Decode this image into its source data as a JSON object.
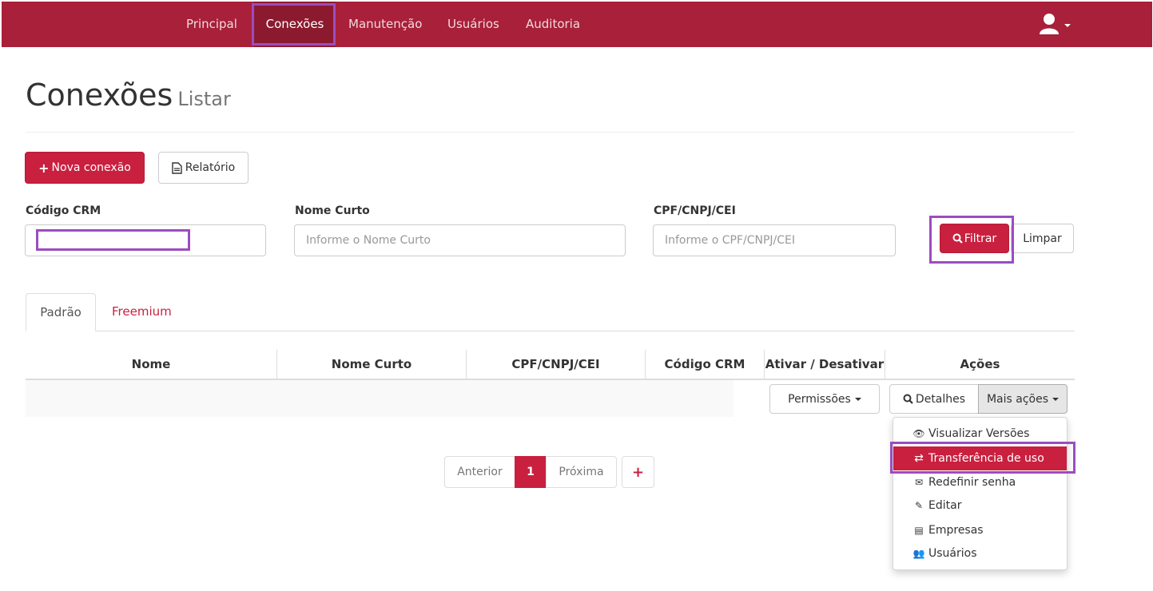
{
  "navbar": {
    "items": [
      {
        "label": "Principal"
      },
      {
        "label": "Conexões"
      },
      {
        "label": "Manutenção"
      },
      {
        "label": "Usuários"
      },
      {
        "label": "Auditoria"
      }
    ],
    "active_item": "Conexões",
    "user_icon": "user-icon",
    "brand_color": "#a82039"
  },
  "page": {
    "title": "Conexões",
    "subtitle": "Listar"
  },
  "actions": {
    "new_label": "Nova conexão",
    "new_icon": "plus-icon",
    "report_label": "Relatório",
    "report_icon": "document-icon"
  },
  "filters": {
    "codigo_crm": {
      "label": "Código CRM",
      "value": "",
      "placeholder": ""
    },
    "nome_curto": {
      "label": "Nome Curto",
      "placeholder": "Informe o Nome Curto"
    },
    "cpf": {
      "label": "CPF/CNPJ/CEI",
      "placeholder": "Informe o CPF/CNPJ/CEI"
    },
    "filter_label": "Filtrar",
    "filter_icon": "search-icon",
    "clear_label": "Limpar"
  },
  "tabs": [
    {
      "label": "Padrão",
      "active": true
    },
    {
      "label": "Freemium",
      "active": false
    }
  ],
  "table": {
    "columns": [
      "Nome",
      "Nome Curto",
      "CPF/CNPJ/CEI",
      "Código CRM",
      "Ativar / Desativar",
      "Ações"
    ],
    "row": {
      "permissions_label": "Permissões",
      "details_label": "Detalhes",
      "more_label": "Mais ações"
    }
  },
  "more_actions_menu": [
    {
      "label": "Visualizar Versões",
      "icon": "eye-icon"
    },
    {
      "label": "Transferência de uso",
      "icon": "transfer-icon",
      "highlighted": true
    },
    {
      "label": "Redefinir senha",
      "icon": "envelope-icon"
    },
    {
      "label": "Editar",
      "icon": "edit-icon"
    },
    {
      "label": "Empresas",
      "icon": "list-icon"
    },
    {
      "label": "Usuários",
      "icon": "users-icon"
    }
  ],
  "pagination": {
    "previous": "Anterior",
    "current_page": "1",
    "next": "Próxima",
    "add_icon": "plus-icon"
  },
  "colors": {
    "accent": "#c9203f",
    "highlight_outline": "#9b4dbf"
  }
}
